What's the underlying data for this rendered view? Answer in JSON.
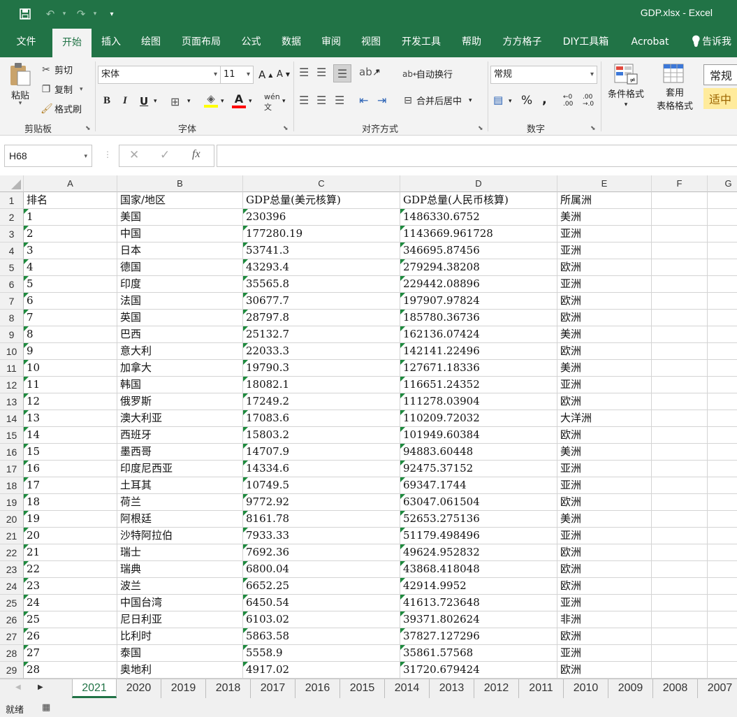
{
  "window": {
    "title": "GDP.xlsx  -  Excel"
  },
  "menu_tabs": [
    {
      "label": "文件",
      "active": false
    },
    {
      "label": "开始",
      "active": true
    },
    {
      "label": "插入",
      "active": false
    },
    {
      "label": "绘图",
      "active": false
    },
    {
      "label": "页面布局",
      "active": false
    },
    {
      "label": "公式",
      "active": false
    },
    {
      "label": "数据",
      "active": false
    },
    {
      "label": "审阅",
      "active": false
    },
    {
      "label": "视图",
      "active": false
    },
    {
      "label": "开发工具",
      "active": false
    },
    {
      "label": "帮助",
      "active": false
    },
    {
      "label": "方方格子",
      "active": false
    },
    {
      "label": "DIY工具箱",
      "active": false
    },
    {
      "label": "Acrobat",
      "active": false
    },
    {
      "label": "告诉我",
      "active": false
    }
  ],
  "ribbon": {
    "clipboard": {
      "paste": "粘贴",
      "cut": "剪切",
      "copy": "复制",
      "format_painter": "格式刷",
      "label": "剪贴板"
    },
    "font": {
      "name": "宋体",
      "size": "11",
      "label": "字体"
    },
    "alignment": {
      "wrap": "自动换行",
      "merge": "合并后居中",
      "label": "对齐方式"
    },
    "number": {
      "format": "常规",
      "label": "数字"
    },
    "styles": {
      "conditional": "条件格式",
      "table_line1": "套用",
      "table_line2": "表格格式",
      "style_normal": "常规",
      "style_neutral": "适中"
    }
  },
  "formula_bar": {
    "name_box": "H68",
    "fx": "fx",
    "value": ""
  },
  "columns": [
    "A",
    "B",
    "C",
    "D",
    "E",
    "F",
    "G"
  ],
  "table": {
    "header": [
      "排名",
      "国家/地区",
      "GDP总量(美元核算)",
      "GDP总量(人民币核算)",
      "所属洲"
    ],
    "rows": [
      [
        "1",
        "美国",
        "230396",
        "1486330.6752",
        "美洲"
      ],
      [
        "2",
        "中国",
        "177280.19",
        "1143669.961728",
        "亚洲"
      ],
      [
        "3",
        "日本",
        "53741.3",
        "346695.87456",
        "亚洲"
      ],
      [
        "4",
        "德国",
        "43293.4",
        "279294.38208",
        "欧洲"
      ],
      [
        "5",
        "印度",
        "35565.8",
        "229442.08896",
        "亚洲"
      ],
      [
        "6",
        "法国",
        "30677.7",
        "197907.97824",
        "欧洲"
      ],
      [
        "7",
        "英国",
        "28797.8",
        "185780.36736",
        "欧洲"
      ],
      [
        "8",
        "巴西",
        "25132.7",
        "162136.07424",
        "美洲"
      ],
      [
        "9",
        "意大利",
        "22033.3",
        "142141.22496",
        "欧洲"
      ],
      [
        "10",
        "加拿大",
        "19790.3",
        "127671.18336",
        "美洲"
      ],
      [
        "11",
        "韩国",
        "18082.1",
        "116651.24352",
        "亚洲"
      ],
      [
        "12",
        "俄罗斯",
        "17249.2",
        "111278.03904",
        "欧洲"
      ],
      [
        "13",
        "澳大利亚",
        "17083.6",
        "110209.72032",
        "大洋洲"
      ],
      [
        "14",
        "西班牙",
        "15803.2",
        "101949.60384",
        "欧洲"
      ],
      [
        "15",
        "墨西哥",
        "14707.9",
        "94883.60448",
        "美洲"
      ],
      [
        "16",
        "印度尼西亚",
        "14334.6",
        "92475.37152",
        "亚洲"
      ],
      [
        "17",
        "土耳其",
        "10749.5",
        "69347.1744",
        "亚洲"
      ],
      [
        "18",
        "荷兰",
        "9772.92",
        "63047.061504",
        "欧洲"
      ],
      [
        "19",
        "阿根廷",
        "8161.78",
        "52653.275136",
        "美洲"
      ],
      [
        "20",
        "沙特阿拉伯",
        "7933.33",
        "51179.498496",
        "亚洲"
      ],
      [
        "21",
        "瑞士",
        "7692.36",
        "49624.952832",
        "欧洲"
      ],
      [
        "22",
        "瑞典",
        "6800.04",
        "43868.418048",
        "欧洲"
      ],
      [
        "23",
        "波兰",
        "6652.25",
        "42914.9952",
        "欧洲"
      ],
      [
        "24",
        "中国台湾",
        "6450.54",
        "41613.723648",
        "亚洲"
      ],
      [
        "25",
        "尼日利亚",
        "6103.02",
        "39371.802624",
        "非洲"
      ],
      [
        "26",
        "比利时",
        "5863.58",
        "37827.127296",
        "欧洲"
      ],
      [
        "27",
        "泰国",
        "5558.9",
        "35861.57568",
        "亚洲"
      ],
      [
        "28",
        "奥地利",
        "4917.02",
        "31720.679424",
        "欧洲"
      ]
    ]
  },
  "sheets": [
    "2021",
    "2020",
    "2019",
    "2018",
    "2017",
    "2016",
    "2015",
    "2014",
    "2013",
    "2012",
    "2011",
    "2010",
    "2009",
    "2008",
    "2007"
  ],
  "active_sheet": "2021",
  "status": {
    "text": "就绪"
  },
  "colors": {
    "brand": "#217346",
    "indicator": "#1e8a3e"
  }
}
